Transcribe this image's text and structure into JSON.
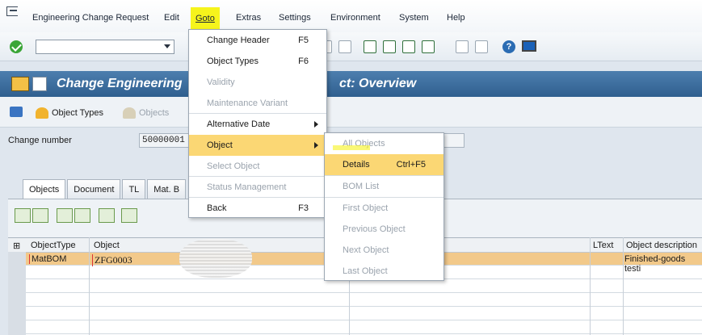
{
  "menubar": {
    "items": [
      "Engineering Change Request",
      "Edit",
      "Goto",
      "Extras",
      "Settings",
      "Environment",
      "System",
      "Help"
    ]
  },
  "title": {
    "text": "Change Engineering",
    "text_end": "ct: Overview"
  },
  "app_toolbar": {
    "object_types": "Object Types",
    "objects": "Objects"
  },
  "header": {
    "change_number_label": "Change number",
    "change_number_value": "50000001"
  },
  "tabs": [
    "Objects",
    "Document",
    "TL",
    "Mat. B"
  ],
  "grid": {
    "headers": {
      "object_type": "ObjectType",
      "object": "Object",
      "ltext": "LText",
      "object_description": "Object description"
    },
    "rows": [
      {
        "object_type": "MatBOM",
        "object": "ZFG0003",
        "description": "Finished-goods testi"
      }
    ]
  },
  "goto_menu": {
    "items": [
      {
        "label": "Change Header",
        "shortcut": "F5",
        "disabled": false
      },
      {
        "label": "Object Types",
        "shortcut": "F6",
        "disabled": false
      },
      {
        "label": "Validity",
        "shortcut": "",
        "disabled": true
      },
      {
        "label": "Maintenance Variant",
        "shortcut": "",
        "disabled": true
      },
      {
        "label": "Alternative Date",
        "shortcut": "",
        "disabled": false
      },
      {
        "label": "Object",
        "shortcut": "",
        "disabled": false
      },
      {
        "label": "Select Object",
        "shortcut": "",
        "disabled": true
      },
      {
        "label": "Status Management",
        "shortcut": "",
        "disabled": true
      },
      {
        "label": "Back",
        "shortcut": "F3",
        "disabled": false
      }
    ]
  },
  "object_submenu": {
    "items": [
      {
        "label": "All Objects",
        "shortcut": "",
        "disabled": true
      },
      {
        "label": "Details",
        "shortcut": "Ctrl+F5",
        "disabled": false
      },
      {
        "label": "BOM List",
        "shortcut": "",
        "disabled": true
      },
      {
        "label": "First Object",
        "shortcut": "",
        "disabled": true
      },
      {
        "label": "Previous Object",
        "shortcut": "",
        "disabled": true
      },
      {
        "label": "Next Object",
        "shortcut": "",
        "disabled": true
      },
      {
        "label": "Last Object",
        "shortcut": "",
        "disabled": true
      }
    ]
  },
  "colors": {
    "highlight": "#f6f41c",
    "menu_hover": "#fbd774",
    "title_bar": "#3a6a9a",
    "selected_row": "#f2c98a"
  }
}
